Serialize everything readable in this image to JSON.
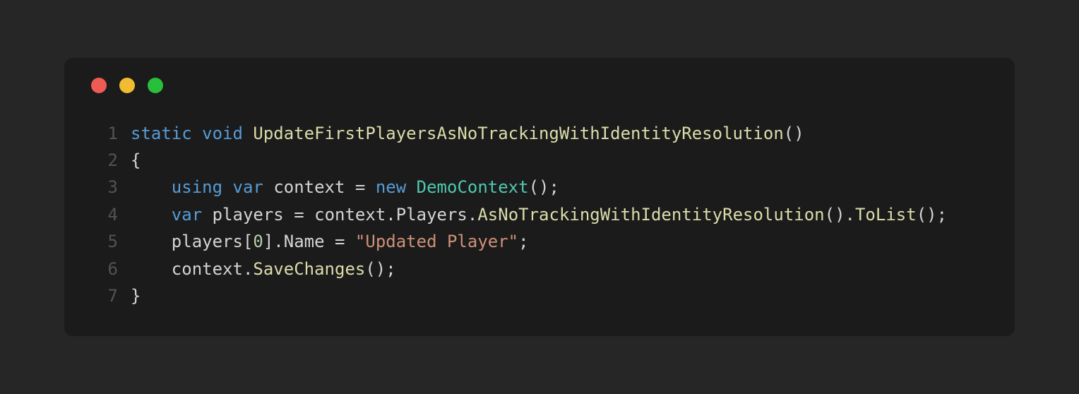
{
  "window": {
    "traffic_lights": {
      "red": "#ee5b54",
      "yellow": "#f1bb32",
      "green": "#27c03b"
    }
  },
  "code": {
    "lines": [
      {
        "num": "1",
        "tokens": [
          {
            "t": "static",
            "c": "tok-keyword"
          },
          {
            "t": " ",
            "c": "tok-punc"
          },
          {
            "t": "void",
            "c": "tok-keyword"
          },
          {
            "t": " ",
            "c": "tok-punc"
          },
          {
            "t": "UpdateFirstPlayersAsNoTrackingWithIdentityResolution",
            "c": "tok-method"
          },
          {
            "t": "()",
            "c": "tok-punc"
          }
        ]
      },
      {
        "num": "2",
        "tokens": [
          {
            "t": "{",
            "c": "tok-punc"
          }
        ]
      },
      {
        "num": "3",
        "tokens": [
          {
            "t": "    ",
            "c": "tok-punc"
          },
          {
            "t": "using",
            "c": "tok-keyword"
          },
          {
            "t": " ",
            "c": "tok-punc"
          },
          {
            "t": "var",
            "c": "tok-keyword"
          },
          {
            "t": " ",
            "c": "tok-punc"
          },
          {
            "t": "context",
            "c": "tok-ident"
          },
          {
            "t": " = ",
            "c": "tok-punc"
          },
          {
            "t": "new",
            "c": "tok-keyword"
          },
          {
            "t": " ",
            "c": "tok-punc"
          },
          {
            "t": "DemoContext",
            "c": "tok-type"
          },
          {
            "t": "();",
            "c": "tok-punc"
          }
        ]
      },
      {
        "num": "4",
        "tokens": [
          {
            "t": "    ",
            "c": "tok-punc"
          },
          {
            "t": "var",
            "c": "tok-keyword"
          },
          {
            "t": " ",
            "c": "tok-punc"
          },
          {
            "t": "players",
            "c": "tok-ident"
          },
          {
            "t": " = ",
            "c": "tok-punc"
          },
          {
            "t": "context",
            "c": "tok-ident"
          },
          {
            "t": ".",
            "c": "tok-punc"
          },
          {
            "t": "Players",
            "c": "tok-ident"
          },
          {
            "t": ".",
            "c": "tok-punc"
          },
          {
            "t": "AsNoTrackingWithIdentityResolution",
            "c": "tok-method"
          },
          {
            "t": "().",
            "c": "tok-punc"
          },
          {
            "t": "ToList",
            "c": "tok-method"
          },
          {
            "t": "();",
            "c": "tok-punc"
          }
        ]
      },
      {
        "num": "5",
        "tokens": [
          {
            "t": "    ",
            "c": "tok-punc"
          },
          {
            "t": "players",
            "c": "tok-ident"
          },
          {
            "t": "[",
            "c": "tok-punc"
          },
          {
            "t": "0",
            "c": "tok-number"
          },
          {
            "t": "].",
            "c": "tok-punc"
          },
          {
            "t": "Name",
            "c": "tok-ident"
          },
          {
            "t": " = ",
            "c": "tok-punc"
          },
          {
            "t": "\"Updated Player\"",
            "c": "tok-string"
          },
          {
            "t": ";",
            "c": "tok-punc"
          }
        ]
      },
      {
        "num": "6",
        "tokens": [
          {
            "t": "    ",
            "c": "tok-punc"
          },
          {
            "t": "context",
            "c": "tok-ident"
          },
          {
            "t": ".",
            "c": "tok-punc"
          },
          {
            "t": "SaveChanges",
            "c": "tok-method"
          },
          {
            "t": "();",
            "c": "tok-punc"
          }
        ]
      },
      {
        "num": "7",
        "tokens": [
          {
            "t": "}",
            "c": "tok-punc"
          }
        ]
      }
    ]
  }
}
